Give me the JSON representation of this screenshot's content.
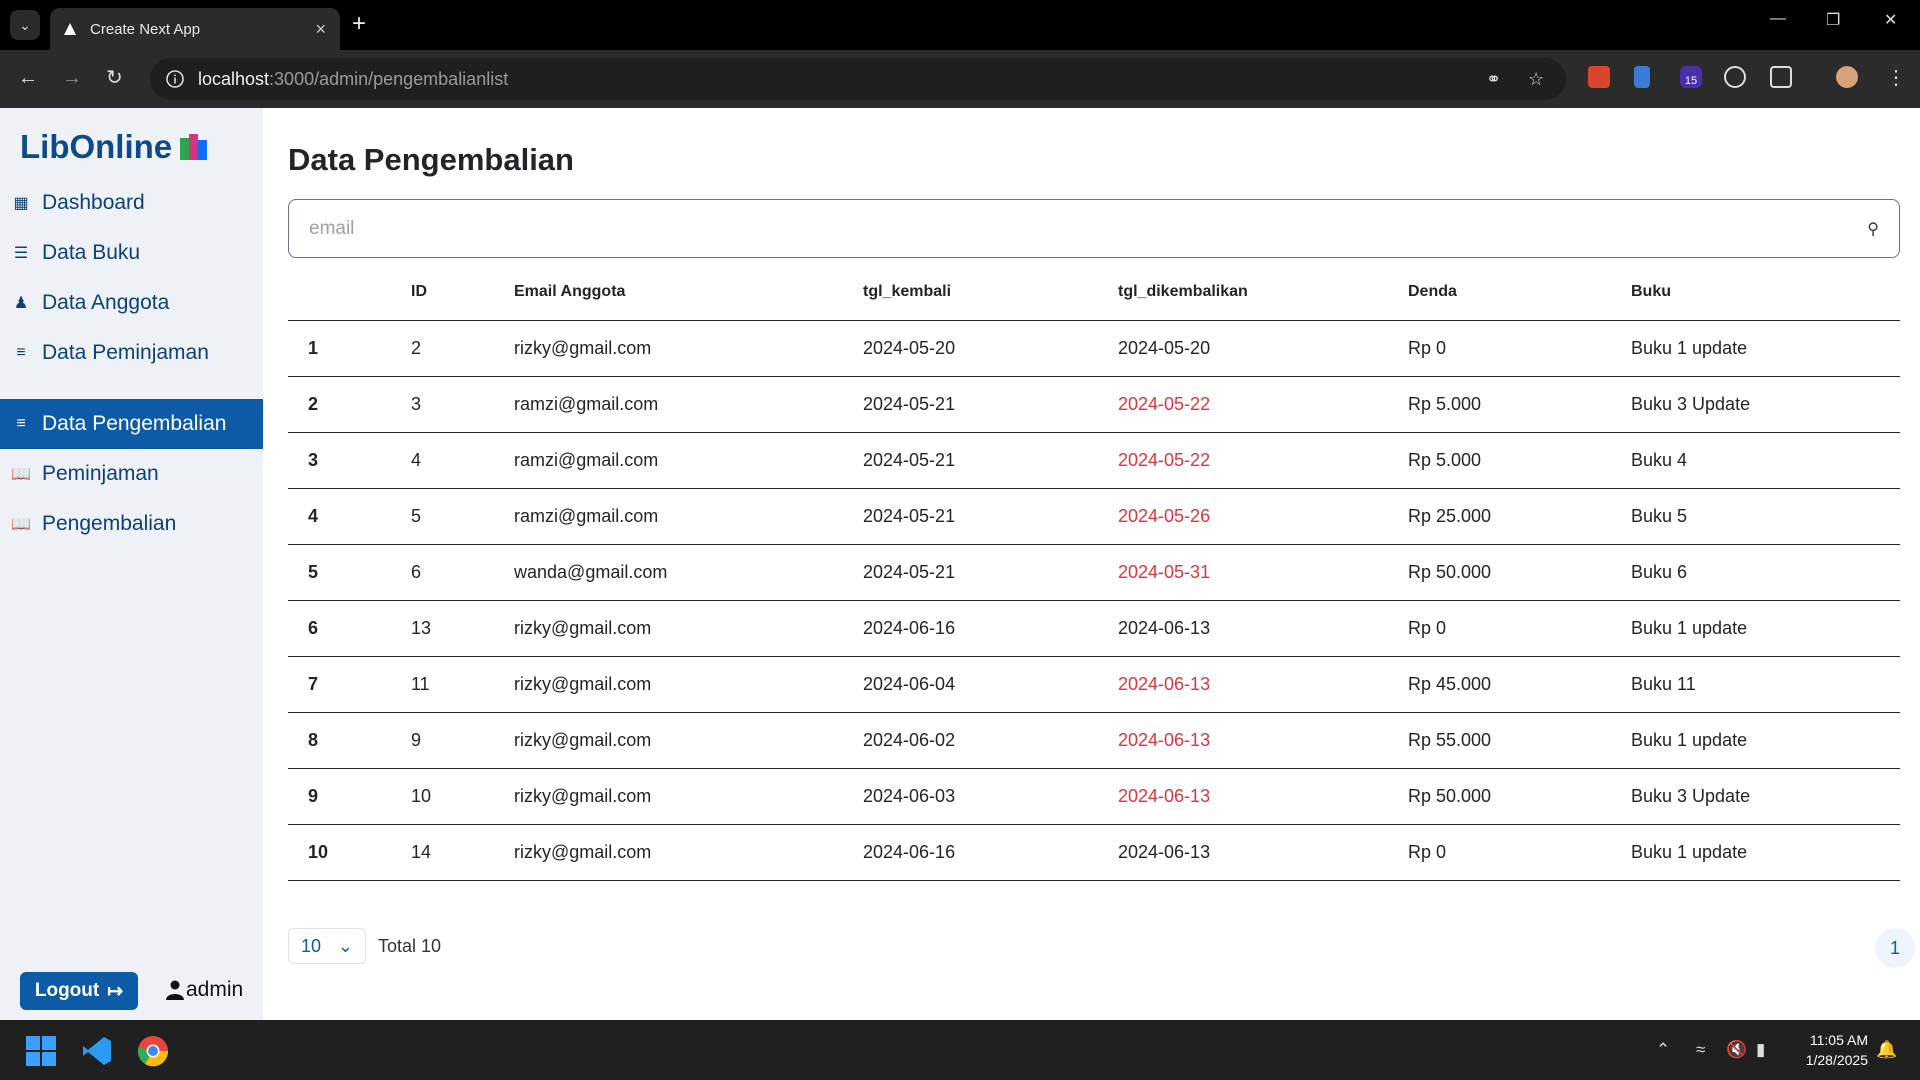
{
  "browser": {
    "tab_title": "Create Next App",
    "url_host": "localhost",
    "url_path": ":3000/admin/pengembalianlist",
    "extension_badge": "15"
  },
  "sidebar": {
    "brand": "LibOnline",
    "items": [
      {
        "label": "Dashboard",
        "icon": "grid-icon",
        "active": false
      },
      {
        "label": "Data Buku",
        "icon": "list-icon",
        "active": false
      },
      {
        "label": "Data Anggota",
        "icon": "users-icon",
        "active": false
      },
      {
        "label": "Data Peminjaman",
        "icon": "layers-icon",
        "active": false
      },
      {
        "label": "Data Pengembalian",
        "icon": "layers-icon",
        "active": true
      },
      {
        "label": "Peminjaman",
        "icon": "book-icon",
        "active": false
      },
      {
        "label": "Pengembalian",
        "icon": "book-icon",
        "active": false
      }
    ],
    "logout_label": "Logout",
    "username": "admin"
  },
  "main": {
    "title": "Data Pengembalian",
    "search_placeholder": "email",
    "columns": [
      "",
      "ID",
      "Email Anggota",
      "tgl_kembali",
      "tgl_dikembalikan",
      "Denda",
      "Buku"
    ],
    "rows": [
      {
        "no": "1",
        "id": "2",
        "email": "rizky@gmail.com",
        "tgl_kembali": "2024-05-20",
        "tgl_dikembalikan": "2024-05-20",
        "late": false,
        "denda": "Rp 0",
        "buku": "Buku 1 update"
      },
      {
        "no": "2",
        "id": "3",
        "email": "ramzi@gmail.com",
        "tgl_kembali": "2024-05-21",
        "tgl_dikembalikan": "2024-05-22",
        "late": true,
        "denda": "Rp 5.000",
        "buku": "Buku 3 Update"
      },
      {
        "no": "3",
        "id": "4",
        "email": "ramzi@gmail.com",
        "tgl_kembali": "2024-05-21",
        "tgl_dikembalikan": "2024-05-22",
        "late": true,
        "denda": "Rp 5.000",
        "buku": "Buku 4"
      },
      {
        "no": "4",
        "id": "5",
        "email": "ramzi@gmail.com",
        "tgl_kembali": "2024-05-21",
        "tgl_dikembalikan": "2024-05-26",
        "late": true,
        "denda": "Rp 25.000",
        "buku": "Buku 5"
      },
      {
        "no": "5",
        "id": "6",
        "email": "wanda@gmail.com",
        "tgl_kembali": "2024-05-21",
        "tgl_dikembalikan": "2024-05-31",
        "late": true,
        "denda": "Rp 50.000",
        "buku": "Buku 6"
      },
      {
        "no": "6",
        "id": "13",
        "email": "rizky@gmail.com",
        "tgl_kembali": "2024-06-16",
        "tgl_dikembalikan": "2024-06-13",
        "late": false,
        "denda": "Rp 0",
        "buku": "Buku 1 update"
      },
      {
        "no": "7",
        "id": "11",
        "email": "rizky@gmail.com",
        "tgl_kembali": "2024-06-04",
        "tgl_dikembalikan": "2024-06-13",
        "late": true,
        "denda": "Rp 45.000",
        "buku": "Buku 11"
      },
      {
        "no": "8",
        "id": "9",
        "email": "rizky@gmail.com",
        "tgl_kembali": "2024-06-02",
        "tgl_dikembalikan": "2024-06-13",
        "late": true,
        "denda": "Rp 55.000",
        "buku": "Buku 1 update"
      },
      {
        "no": "9",
        "id": "10",
        "email": "rizky@gmail.com",
        "tgl_kembali": "2024-06-03",
        "tgl_dikembalikan": "2024-06-13",
        "late": true,
        "denda": "Rp 50.000",
        "buku": "Buku 3 Update"
      },
      {
        "no": "10",
        "id": "14",
        "email": "rizky@gmail.com",
        "tgl_kembali": "2024-06-16",
        "tgl_dikembalikan": "2024-06-13",
        "late": false,
        "denda": "Rp 0",
        "buku": "Buku 1 update"
      }
    ],
    "page_size": "10",
    "total_label": "Total 10",
    "current_page": "1"
  },
  "taskbar": {
    "time": "11:05 AM",
    "date": "1/28/2025"
  },
  "colors": {
    "accent": "#0d5aa7",
    "late": "#d9363e"
  }
}
